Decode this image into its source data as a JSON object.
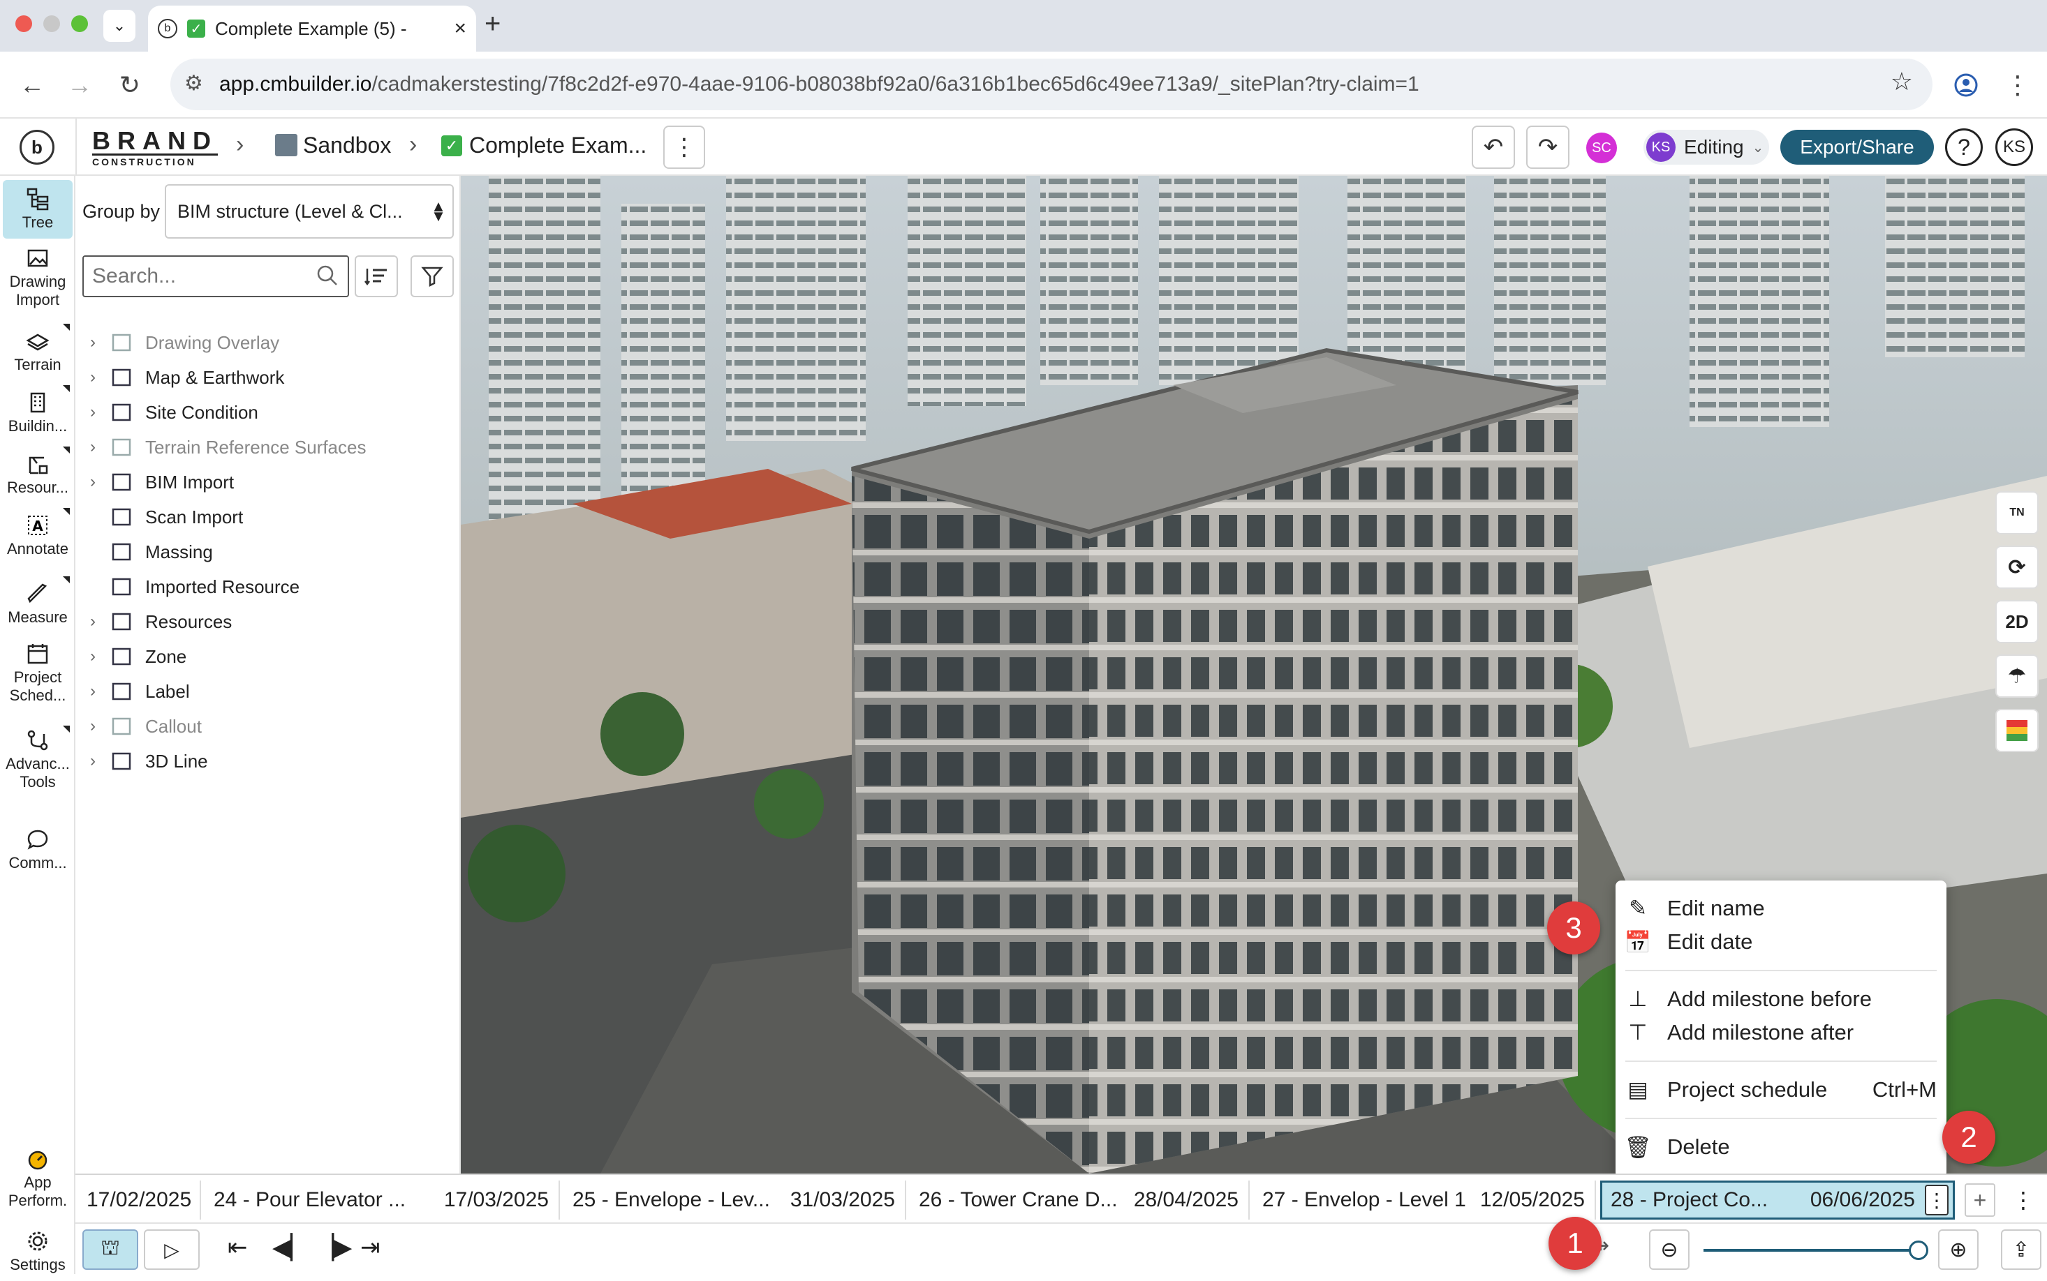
{
  "browser": {
    "tab_title": "Complete Example (5) -",
    "url_host": "app.cmbuilder.io",
    "url_path": "/cadmakerstesting/7f8c2d2f-e970-4aae-9106-b08038bf92a0/6a316b1bec65d6c49ee713a9/_sitePlan?try-claim=1"
  },
  "header": {
    "brand_top": "BRAND",
    "brand_bottom": "CONSTRUCTION",
    "crumb_1": "Sandbox",
    "crumb_2": "Complete Exam...",
    "user_sc": "SC",
    "user_ks": "KS",
    "mode": "Editing",
    "export_label": "Export/Share",
    "help": "?",
    "avatar": "KS"
  },
  "rail": {
    "items": [
      {
        "label": "Tree"
      },
      {
        "label": "Drawing Import"
      },
      {
        "label": "Terrain"
      },
      {
        "label": "Buildin..."
      },
      {
        "label": "Resour..."
      },
      {
        "label": "Annotate"
      },
      {
        "label": "Measure"
      },
      {
        "label": "Project Sched..."
      },
      {
        "label": "Advanc... Tools"
      },
      {
        "label": "Comm..."
      },
      {
        "label": "App Perform."
      },
      {
        "label": "Settings"
      }
    ]
  },
  "panel": {
    "group_by_label": "Group by",
    "group_by_value": "BIM structure (Level & Cl...",
    "search_placeholder": "Search...",
    "tree": [
      {
        "label": "Drawing Overlay",
        "muted": true
      },
      {
        "label": "Map & Earthwork",
        "muted": false
      },
      {
        "label": "Site Condition",
        "muted": false
      },
      {
        "label": "Terrain Reference Surfaces",
        "muted": true
      },
      {
        "label": "BIM Import",
        "muted": false
      },
      {
        "label": "Scan Import",
        "muted": false
      },
      {
        "label": "Massing",
        "muted": false
      },
      {
        "label": "Imported Resource",
        "muted": false
      },
      {
        "label": "Resources",
        "muted": false
      },
      {
        "label": "Zone",
        "muted": false
      },
      {
        "label": "Label",
        "muted": false
      },
      {
        "label": "Callout",
        "muted": true
      },
      {
        "label": "3D Line",
        "muted": false
      }
    ]
  },
  "timeline": {
    "milestones": [
      {
        "name": "",
        "date": "17/02/2025"
      },
      {
        "name": "24 - Pour Elevator ...",
        "date": "17/03/2025"
      },
      {
        "name": "25 - Envelope - Lev...",
        "date": "31/03/2025"
      },
      {
        "name": "26 - Tower Crane D...",
        "date": "28/04/2025"
      },
      {
        "name": "27 - Envelop - Level 1",
        "date": "12/05/2025"
      },
      {
        "name": "28 - Project Co...",
        "date": "06/06/2025"
      }
    ]
  },
  "context_menu": {
    "edit_name": "Edit name",
    "edit_date": "Edit date",
    "add_before": "Add milestone before",
    "add_after": "Add milestone after",
    "schedule": "Project schedule",
    "schedule_shortcut": "Ctrl+M",
    "delete": "Delete"
  },
  "callouts": {
    "one": "1",
    "two": "2",
    "three": "3"
  },
  "view_tools": {
    "north": "TN",
    "two_d": "2D"
  },
  "colors": {
    "accent": "#1f5d78",
    "highlight": "#bfe4ee",
    "callout": "#e03c3c",
    "avatar_purple": "#7d3ccf",
    "avatar_pink": "#d42fd6"
  }
}
